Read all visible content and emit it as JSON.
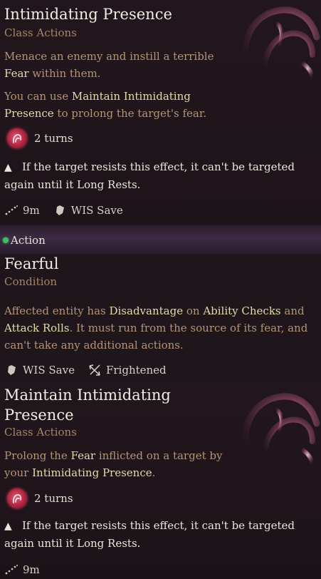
{
  "card1": {
    "title": "Intimidating Presence",
    "category": "Class Actions",
    "desc_a": "Menace an enemy and instill a terrible",
    "desc_fear": "Fear",
    "desc_b": " within them.",
    "use_a": "You can use ",
    "use_link1": "Maintain Intimidating",
    "use_link2": "Presence",
    "use_b": " to prolong the target's fear.",
    "duration": "2 turns",
    "warning_line1": "If the target resists this effect, it can't be targeted",
    "warning_line2": "again until it Long Rests.",
    "range": "9m",
    "save": "WIS Save",
    "cost_label": "Action",
    "icon": "fear-hand-icon"
  },
  "condition": {
    "title": "Fearful",
    "category": "Condition",
    "line1_a": "Affected entity has ",
    "line1_dis": "Disadvantage",
    "line1_on": " on ",
    "line1_checks": "Ability Checks",
    "line1_and": " and",
    "line2_attack": "Attack Rolls",
    "line2_b": ". It must run from the source of its fear, and",
    "line3": "can't take any additional actions.",
    "save": "WIS Save",
    "status": "Frightened"
  },
  "card2": {
    "title_line1": "Maintain Intimidating",
    "title_line2": "Presence",
    "category": "Class Actions",
    "desc_a": "Prolong the ",
    "desc_fear": "Fear",
    "desc_b": " inflicted on a target by",
    "desc_c": "your ",
    "desc_link": "Intimidating Presence",
    "desc_d": ".",
    "duration": "2 turns",
    "warning_line1": "If the target resists this effect, it can't be targeted",
    "warning_line2": "again until it Long Rests.",
    "range": "9m"
  },
  "colors": {
    "accent_text": "#e6dba8",
    "body_text": "#b49476",
    "action_dot": "#3fbf63",
    "fear_icon": "#c22d4b"
  }
}
